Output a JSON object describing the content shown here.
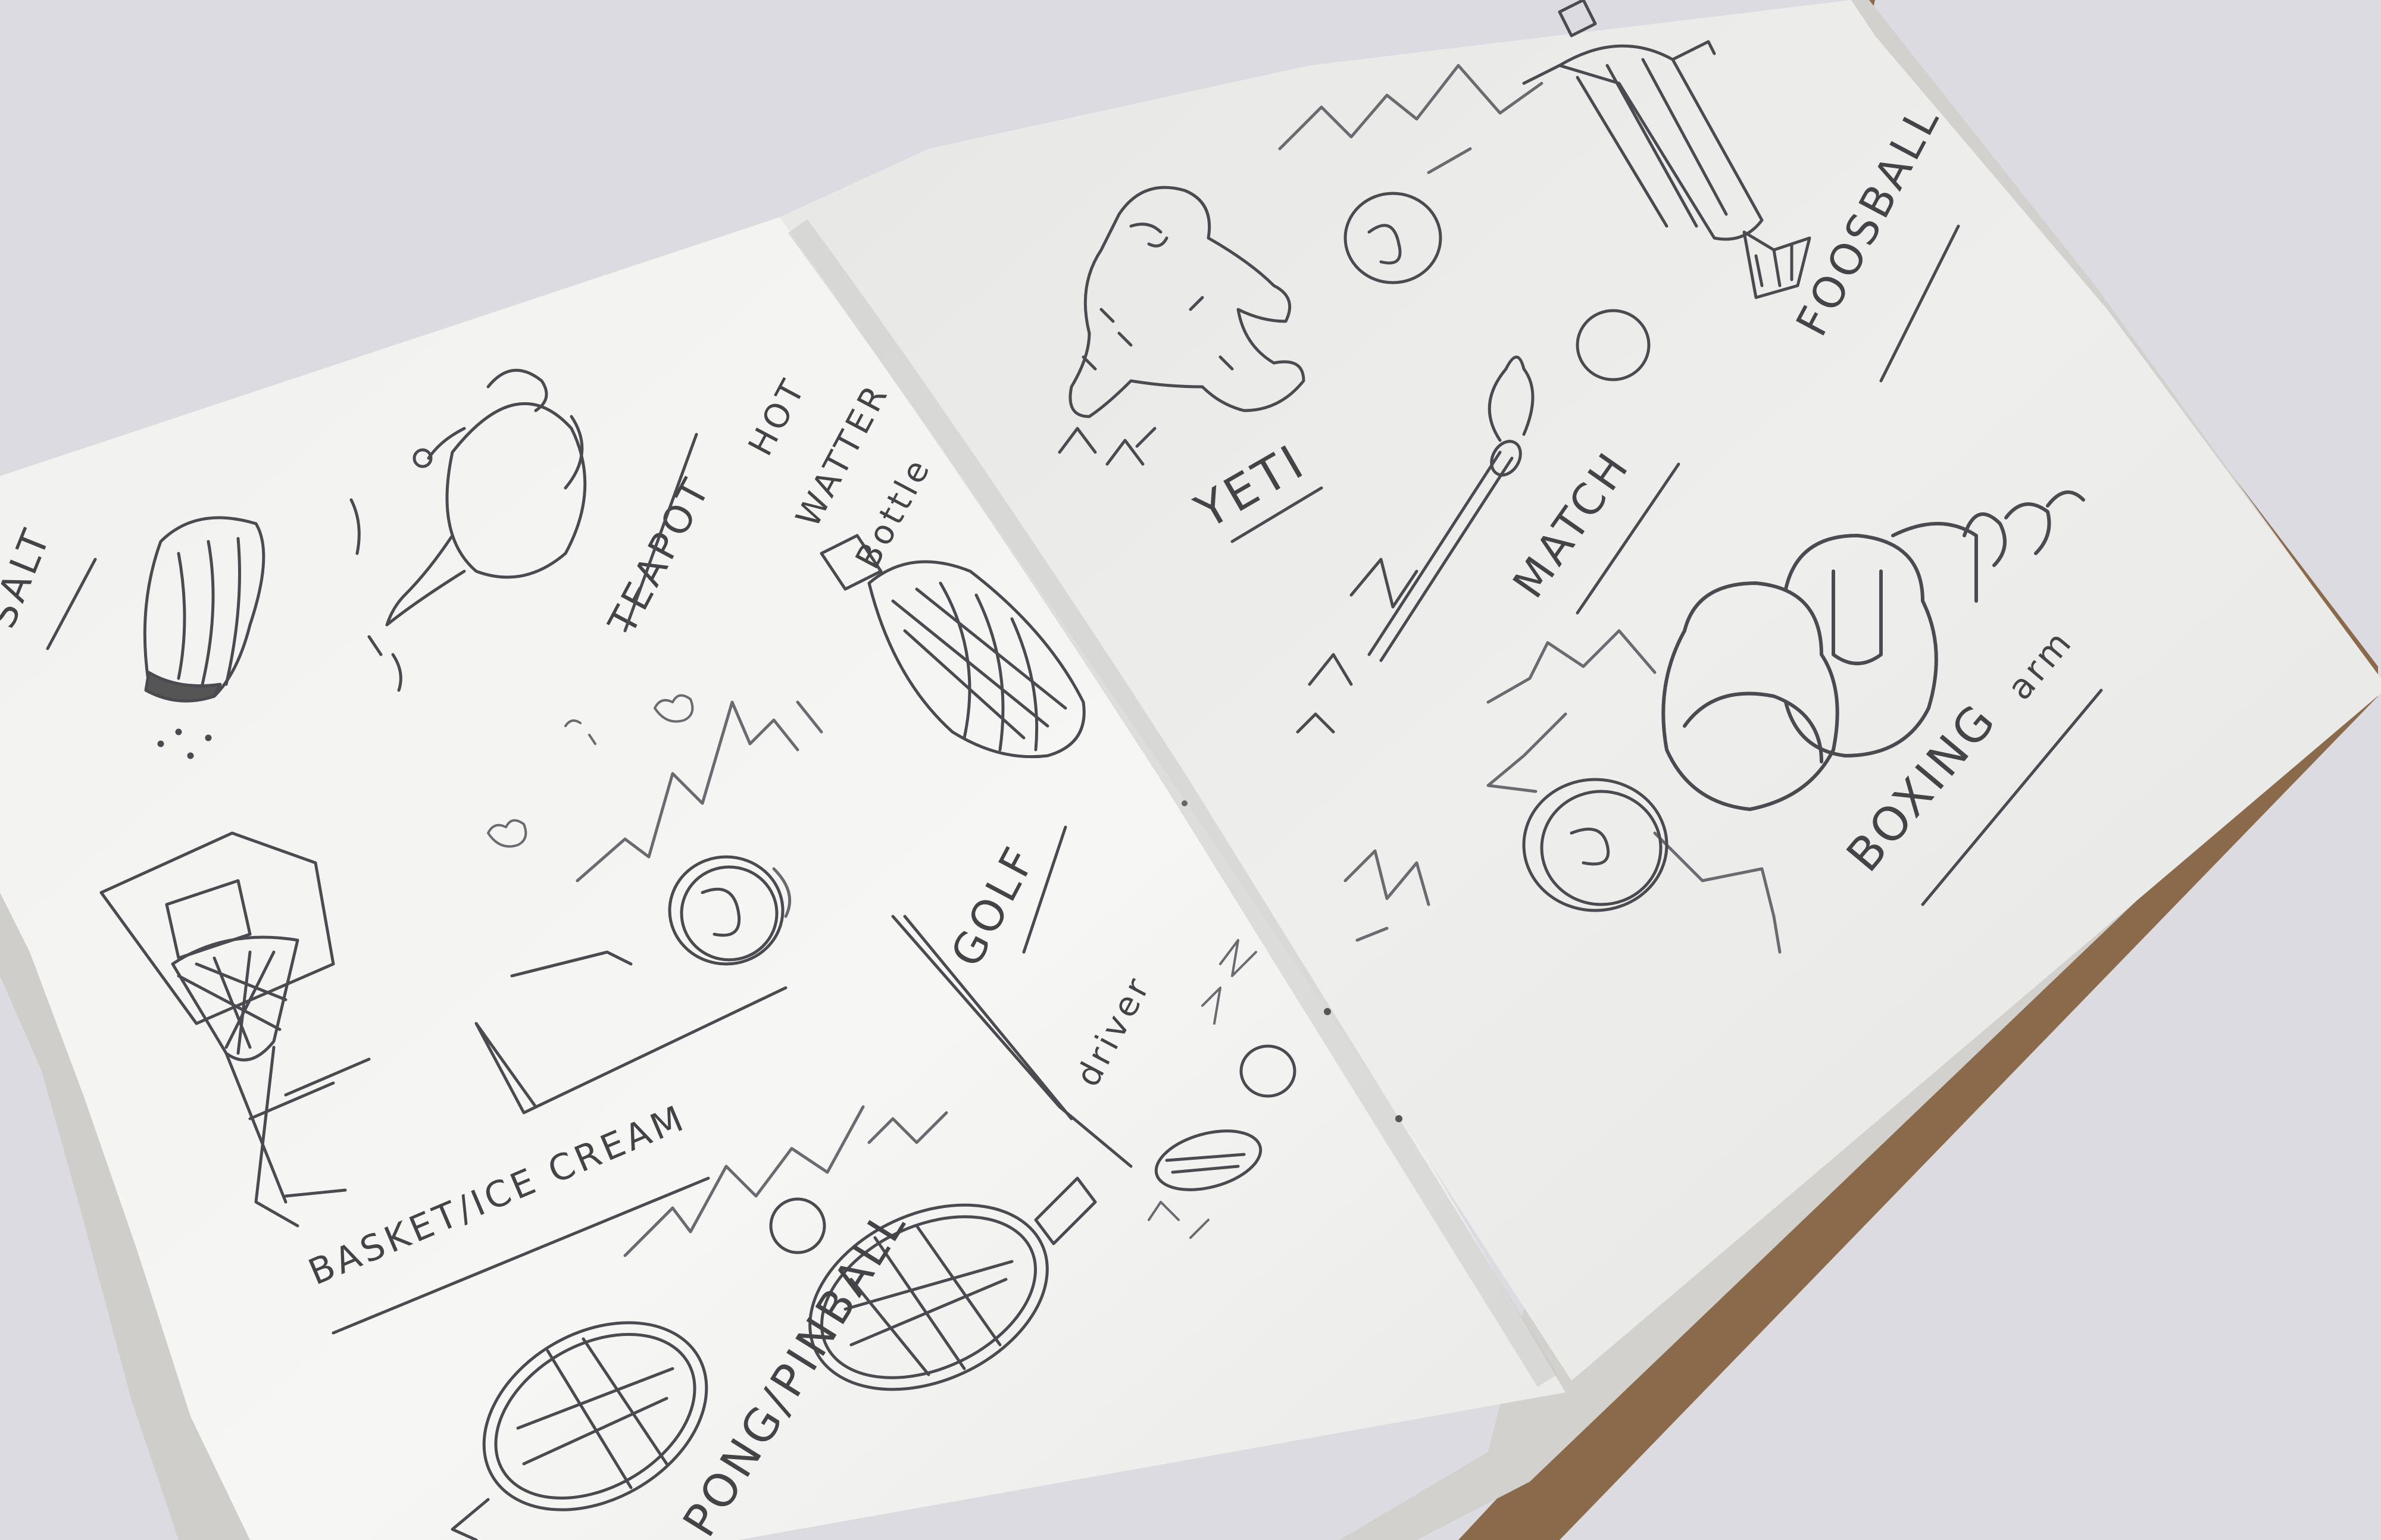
{
  "colors": {
    "background": "#dcdbe1",
    "paper_left": "#f3f3f1",
    "paper_right": "#ececea",
    "cover": "#8a6a4a",
    "ink": "#4a4a50"
  },
  "left_page": {
    "labels": {
      "salt": "SALT",
      "teapot": "TEAPOT",
      "hot": "HOT",
      "water": "WATTER",
      "bottle": "Bottle",
      "golf": "GOLF",
      "driver": "driver",
      "basket_ice_cream": "BASKET/ICE CREAM",
      "ping_pong": "PONG/PINBALL"
    }
  },
  "right_page": {
    "labels": {
      "yeti": "YETI",
      "match": "MATCH",
      "foosball": "FOOSBALL",
      "boxing": "BOXING",
      "arm": "arm"
    }
  }
}
